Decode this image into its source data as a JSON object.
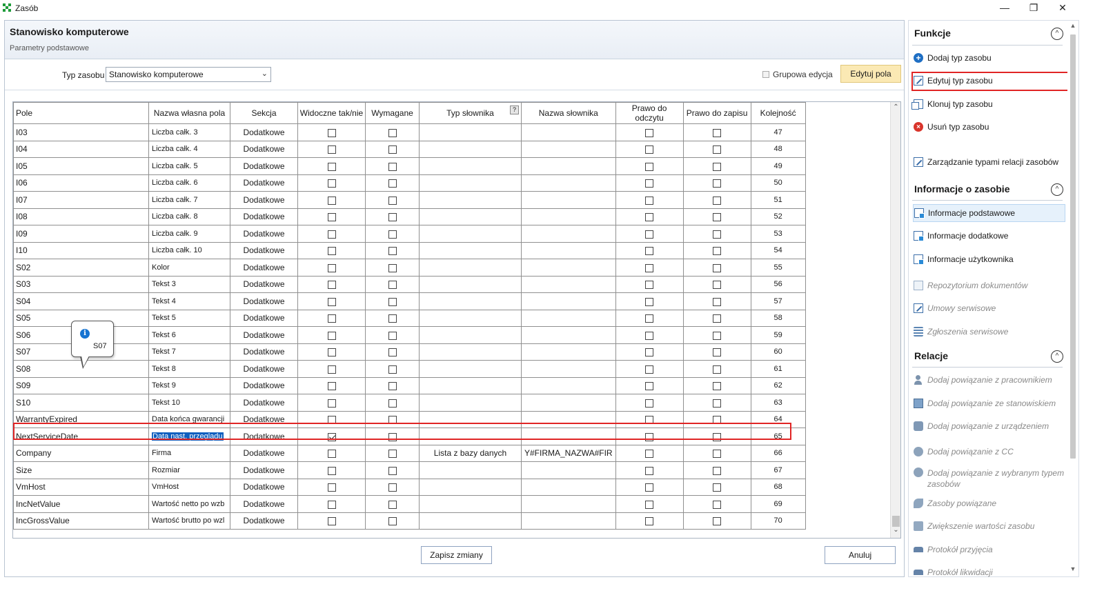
{
  "window": {
    "title": "Zasób",
    "controls": {
      "minimize": "—",
      "restore": "❐",
      "close": "✕"
    }
  },
  "header": {
    "title": "Stanowisko komputerowe",
    "subtitle": "Parametry podstawowe"
  },
  "toolbar": {
    "type_label": "Typ zasobu",
    "type_value": "Stanowisko komputerowe",
    "group_edit_label": "Grupowa edycja",
    "edit_fields_label": "Edytuj pola"
  },
  "grid": {
    "columns": [
      "Pole",
      "Nazwa własna pola",
      "Sekcja",
      "Widoczne tak/nie",
      "Wymagane",
      "Typ słownika",
      "Nazwa słownika",
      "Prawo do odczytu",
      "Prawo do zapisu",
      "Kolejność"
    ],
    "help_mark": "?",
    "rows": [
      {
        "pole": "I03",
        "own": "Liczba całk. 3",
        "sekcja": "Dodatkowe",
        "visible": false,
        "required": false,
        "dict_type": "",
        "dict_name": "",
        "read": false,
        "write": false,
        "order": "47"
      },
      {
        "pole": "I04",
        "own": "Liczba całk. 4",
        "sekcja": "Dodatkowe",
        "visible": false,
        "required": false,
        "dict_type": "",
        "dict_name": "",
        "read": false,
        "write": false,
        "order": "48"
      },
      {
        "pole": "I05",
        "own": "Liczba całk. 5",
        "sekcja": "Dodatkowe",
        "visible": false,
        "required": false,
        "dict_type": "",
        "dict_name": "",
        "read": false,
        "write": false,
        "order": "49"
      },
      {
        "pole": "I06",
        "own": "Liczba całk. 6",
        "sekcja": "Dodatkowe",
        "visible": false,
        "required": false,
        "dict_type": "",
        "dict_name": "",
        "read": false,
        "write": false,
        "order": "50"
      },
      {
        "pole": "I07",
        "own": "Liczba całk. 7",
        "sekcja": "Dodatkowe",
        "visible": false,
        "required": false,
        "dict_type": "",
        "dict_name": "",
        "read": false,
        "write": false,
        "order": "51"
      },
      {
        "pole": "I08",
        "own": "Liczba całk. 8",
        "sekcja": "Dodatkowe",
        "visible": false,
        "required": false,
        "dict_type": "",
        "dict_name": "",
        "read": false,
        "write": false,
        "order": "52"
      },
      {
        "pole": "I09",
        "own": "Liczba całk. 9",
        "sekcja": "Dodatkowe",
        "visible": false,
        "required": false,
        "dict_type": "",
        "dict_name": "",
        "read": false,
        "write": false,
        "order": "53"
      },
      {
        "pole": "I10",
        "own": "Liczba całk. 10",
        "sekcja": "Dodatkowe",
        "visible": false,
        "required": false,
        "dict_type": "",
        "dict_name": "",
        "read": false,
        "write": false,
        "order": "54"
      },
      {
        "pole": "S02",
        "own": "Kolor",
        "sekcja": "Dodatkowe",
        "visible": false,
        "required": false,
        "dict_type": "",
        "dict_name": "",
        "read": false,
        "write": false,
        "order": "55"
      },
      {
        "pole": "S03",
        "own": "Tekst 3",
        "sekcja": "Dodatkowe",
        "visible": false,
        "required": false,
        "dict_type": "",
        "dict_name": "",
        "read": false,
        "write": false,
        "order": "56"
      },
      {
        "pole": "S04",
        "own": "Tekst 4",
        "sekcja": "Dodatkowe",
        "visible": false,
        "required": false,
        "dict_type": "",
        "dict_name": "",
        "read": false,
        "write": false,
        "order": "57"
      },
      {
        "pole": "S05",
        "own": "Tekst 5",
        "sekcja": "Dodatkowe",
        "visible": false,
        "required": false,
        "dict_type": "",
        "dict_name": "",
        "read": false,
        "write": false,
        "order": "58"
      },
      {
        "pole": "S06",
        "own": "Tekst 6",
        "sekcja": "Dodatkowe",
        "visible": false,
        "required": false,
        "dict_type": "",
        "dict_name": "",
        "read": false,
        "write": false,
        "order": "59"
      },
      {
        "pole": "S07",
        "own": "Tekst 7",
        "sekcja": "Dodatkowe",
        "visible": false,
        "required": false,
        "dict_type": "",
        "dict_name": "",
        "read": false,
        "write": false,
        "order": "60"
      },
      {
        "pole": "S08",
        "own": "Tekst 8",
        "sekcja": "Dodatkowe",
        "visible": false,
        "required": false,
        "dict_type": "",
        "dict_name": "",
        "read": false,
        "write": false,
        "order": "61"
      },
      {
        "pole": "S09",
        "own": "Tekst 9",
        "sekcja": "Dodatkowe",
        "visible": false,
        "required": false,
        "dict_type": "",
        "dict_name": "",
        "read": false,
        "write": false,
        "order": "62"
      },
      {
        "pole": "S10",
        "own": "Tekst 10",
        "sekcja": "Dodatkowe",
        "visible": false,
        "required": false,
        "dict_type": "",
        "dict_name": "",
        "read": false,
        "write": false,
        "order": "63"
      },
      {
        "pole": "WarrantyExpired",
        "own": "Data końca gwarancji",
        "sekcja": "Dodatkowe",
        "visible": false,
        "required": false,
        "dict_type": "",
        "dict_name": "",
        "read": false,
        "write": false,
        "order": "64"
      },
      {
        "pole": "NextServiceDate",
        "own": "Data nast. przeglądu",
        "sekcja": "Dodatkowe",
        "visible": true,
        "required": false,
        "dict_type": "",
        "dict_name": "",
        "read": false,
        "write": false,
        "order": "65",
        "highlighted": true
      },
      {
        "pole": "Company",
        "own": "Firma",
        "sekcja": "Dodatkowe",
        "visible": false,
        "required": false,
        "dict_type": "Lista z bazy danych",
        "dict_name": "Y#FIRMA_NAZWA#FIR",
        "read": false,
        "write": false,
        "order": "66"
      },
      {
        "pole": "Size",
        "own": "Rozmiar",
        "sekcja": "Dodatkowe",
        "visible": false,
        "required": false,
        "dict_type": "",
        "dict_name": "",
        "read": false,
        "write": false,
        "order": "67"
      },
      {
        "pole": "VmHost",
        "own": "VmHost",
        "sekcja": "Dodatkowe",
        "visible": false,
        "required": false,
        "dict_type": "",
        "dict_name": "",
        "read": false,
        "write": false,
        "order": "68"
      },
      {
        "pole": "IncNetValue",
        "own": "Wartość netto po wzb",
        "sekcja": "Dodatkowe",
        "visible": false,
        "required": false,
        "dict_type": "",
        "dict_name": "",
        "read": false,
        "write": false,
        "order": "69"
      },
      {
        "pole": "IncGrossValue",
        "own": "Wartość brutto po wzl",
        "sekcja": "Dodatkowe",
        "visible": false,
        "required": false,
        "dict_type": "",
        "dict_name": "",
        "read": false,
        "write": false,
        "order": "70"
      }
    ]
  },
  "tooltip": {
    "text": "S07",
    "icon": "info-icon"
  },
  "footer": {
    "save_label": "Zapisz zmiany",
    "cancel_label": "Anuluj"
  },
  "side": {
    "functions_title": "Funkcje",
    "functions": [
      {
        "label": "Dodaj typ zasobu",
        "icon": "add-icon",
        "disabled": false
      },
      {
        "label": "Edytuj typ zasobu",
        "icon": "edit-icon",
        "disabled": false,
        "highlighted": true
      },
      {
        "label": "Klonuj typ zasobu",
        "icon": "clone-icon",
        "disabled": false
      },
      {
        "label": "Usuń typ zasobu",
        "icon": "delete-icon",
        "disabled": false
      },
      {
        "label": "Zarządzanie typami relacji zasobów",
        "icon": "edit-icon",
        "disabled": false
      }
    ],
    "info_title": "Informacje o zasobie",
    "info": [
      {
        "label": "Informacje podstawowe",
        "icon": "info-form-icon",
        "active": true
      },
      {
        "label": "Informacje dodatkowe",
        "icon": "info-form-icon"
      },
      {
        "label": "Informacje użytkownika",
        "icon": "info-form-icon"
      },
      {
        "label": "Repozytorium dokumentów",
        "icon": "document-icon",
        "disabled": true
      },
      {
        "label": "Umowy serwisowe",
        "icon": "contract-icon",
        "disabled": true
      },
      {
        "label": "Zgłoszenia serwisowe",
        "icon": "stack-icon",
        "disabled": true
      }
    ],
    "relations_title": "Relacje",
    "relations": [
      {
        "label": "Dodaj powiązanie z pracownikiem",
        "icon": "person-icon"
      },
      {
        "label": "Dodaj powiązanie ze stanowiskiem",
        "icon": "monitor-icon"
      },
      {
        "label": "Dodaj powiązanie z urządzeniem",
        "icon": "device-icon"
      },
      {
        "label": "Dodaj powiązanie z CC",
        "icon": "gear-icon"
      },
      {
        "label": "Dodaj powiązanie z wybranym typem zasobów",
        "icon": "gear-icon"
      },
      {
        "label": "Zasoby powiązane",
        "icon": "link-icon"
      },
      {
        "label": "Zwiększenie wartości zasobu",
        "icon": "arrow-up-icon"
      },
      {
        "label": "Protokół przyjęcia",
        "icon": "truck-icon"
      },
      {
        "label": "Protokół likwidacji",
        "icon": "truck-icon"
      }
    ],
    "collapse_glyph": "^"
  },
  "colors": {
    "highlight_border": "#e02424",
    "selection_bg": "#0f5fbf",
    "edit_button_bg": "#fbe9b4"
  }
}
